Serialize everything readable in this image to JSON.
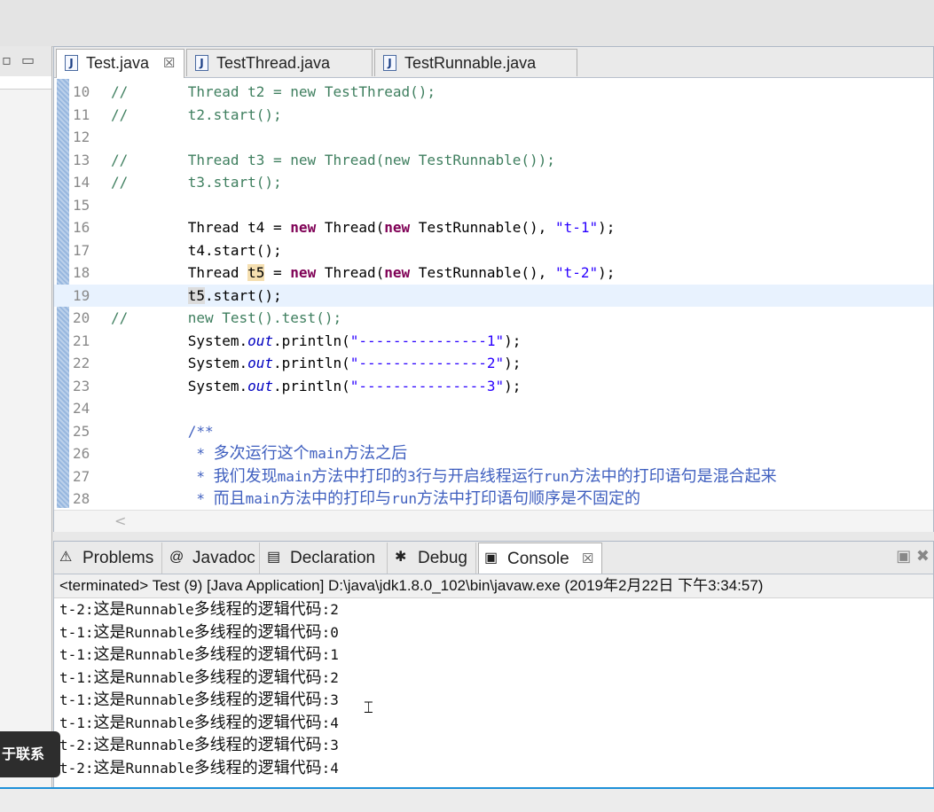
{
  "editor": {
    "tabs": [
      {
        "label": "Test.java",
        "active": true,
        "closable": true
      },
      {
        "label": "TestThread.java",
        "active": false
      },
      {
        "label": "TestRunnable.java",
        "active": false
      }
    ],
    "lines": [
      {
        "num": "10",
        "segs": [
          [
            "cm",
            "//       Thread t2 = new TestThread();"
          ]
        ]
      },
      {
        "num": "11",
        "segs": [
          [
            "cm",
            "//       t2.start();"
          ]
        ]
      },
      {
        "num": "12",
        "segs": []
      },
      {
        "num": "13",
        "segs": [
          [
            "cm",
            "//       Thread t3 = new Thread(new TestRunnable());"
          ]
        ]
      },
      {
        "num": "14",
        "segs": [
          [
            "cm",
            "//       t3.start();"
          ]
        ]
      },
      {
        "num": "15",
        "segs": []
      },
      {
        "num": "16",
        "segs": [
          [
            "",
            "         Thread t4 = "
          ],
          [
            "kw",
            "new"
          ],
          [
            "",
            " Thread("
          ],
          [
            "kw",
            "new"
          ],
          [
            "",
            " TestRunnable(), "
          ],
          [
            "st",
            "\"t-1\""
          ],
          [
            "",
            ");"
          ]
        ]
      },
      {
        "num": "17",
        "segs": [
          [
            "",
            "         t4.start();"
          ]
        ]
      },
      {
        "num": "18",
        "segs": [
          [
            "",
            "         Thread "
          ],
          [
            "occ",
            "t5"
          ],
          [
            "",
            " = "
          ],
          [
            "kw",
            "new"
          ],
          [
            "",
            " Thread("
          ],
          [
            "kw",
            "new"
          ],
          [
            "",
            " TestRunnable(), "
          ],
          [
            "st",
            "\"t-2\""
          ],
          [
            "",
            ");"
          ]
        ]
      },
      {
        "num": "19",
        "current": true,
        "segs": [
          [
            "",
            "         "
          ],
          [
            "occ2",
            "t5"
          ],
          [
            "",
            ".start();"
          ]
        ]
      },
      {
        "num": "20",
        "segs": [
          [
            "cm",
            "//       new Test().test();"
          ]
        ]
      },
      {
        "num": "21",
        "segs": [
          [
            "",
            "         System."
          ],
          [
            "it",
            "out"
          ],
          [
            "",
            ".println("
          ],
          [
            "st",
            "\"---------------1\""
          ],
          [
            "",
            ");"
          ]
        ]
      },
      {
        "num": "22",
        "segs": [
          [
            "",
            "         System."
          ],
          [
            "it",
            "out"
          ],
          [
            "",
            ".println("
          ],
          [
            "st",
            "\"---------------2\""
          ],
          [
            "",
            ");"
          ]
        ]
      },
      {
        "num": "23",
        "segs": [
          [
            "",
            "         System."
          ],
          [
            "it",
            "out"
          ],
          [
            "",
            ".println("
          ],
          [
            "st",
            "\"---------------3\""
          ],
          [
            "",
            ");"
          ]
        ]
      },
      {
        "num": "24",
        "segs": []
      },
      {
        "num": "25",
        "segs": [
          [
            "jd",
            "         /**"
          ]
        ]
      },
      {
        "num": "26",
        "segs": [
          [
            "jd",
            "          * "
          ],
          [
            "jdcn",
            "多次运行这个"
          ],
          [
            "jd",
            "main"
          ],
          [
            "jdcn",
            "方法之后"
          ]
        ]
      },
      {
        "num": "27",
        "segs": [
          [
            "jd",
            "          * "
          ],
          [
            "jdcn",
            "我们发现"
          ],
          [
            "jd",
            "main"
          ],
          [
            "jdcn",
            "方法中打印的"
          ],
          [
            "jd",
            "3"
          ],
          [
            "jdcn",
            "行与开启线程运行"
          ],
          [
            "jd",
            "run"
          ],
          [
            "jdcn",
            "方法中的打印语句是混合起来"
          ]
        ]
      },
      {
        "num": "28",
        "segs": [
          [
            "jd",
            "          * "
          ],
          [
            "jdcn",
            "而且"
          ],
          [
            "jd",
            "main"
          ],
          [
            "jdcn",
            "方法中的打印与"
          ],
          [
            "jd",
            "run"
          ],
          [
            "jdcn",
            "方法中打印语句顺序是不固定的"
          ]
        ]
      }
    ],
    "scroll_hint": "<"
  },
  "console": {
    "tabs": [
      {
        "label": "Problems",
        "icon": "problems-icon",
        "glyph": "⚠"
      },
      {
        "label": "Javadoc",
        "icon": "at-icon",
        "glyph": "@"
      },
      {
        "label": "Declaration",
        "icon": "declaration-icon",
        "glyph": "▤"
      },
      {
        "label": "Debug",
        "icon": "bug-icon",
        "glyph": "✱"
      },
      {
        "label": "Console",
        "icon": "console-icon",
        "glyph": "▣",
        "active": true
      }
    ],
    "status": "<terminated> Test (9) [Java Application] D:\\java\\jdk1.8.0_102\\bin\\javaw.exe (2019年2月22日 下午3:34:57)",
    "output": [
      [
        "t-2:",
        "这是",
        "Runnable",
        "多线程的逻辑代码",
        ":2"
      ],
      [
        "t-1:",
        "这是",
        "Runnable",
        "多线程的逻辑代码",
        ":0"
      ],
      [
        "t-1:",
        "这是",
        "Runnable",
        "多线程的逻辑代码",
        ":1"
      ],
      [
        "t-1:",
        "这是",
        "Runnable",
        "多线程的逻辑代码",
        ":2"
      ],
      [
        "t-1:",
        "这是",
        "Runnable",
        "多线程的逻辑代码",
        ":3"
      ],
      [
        "t-1:",
        "这是",
        "Runnable",
        "多线程的逻辑代码",
        ":4"
      ],
      [
        "t-2:",
        "这是",
        "Runnable",
        "多线程的逻辑代码",
        ":3"
      ],
      [
        "t-2:",
        "这是",
        "Runnable",
        "多线程的逻辑代码",
        ":4"
      ]
    ]
  },
  "overlay": {
    "label": "于联系"
  },
  "colors": {
    "comment": "#3f7f5f",
    "keyword": "#7f0055",
    "string": "#2a00ff",
    "javadoc": "#3f5fbf",
    "accent": "#1e90d8"
  }
}
